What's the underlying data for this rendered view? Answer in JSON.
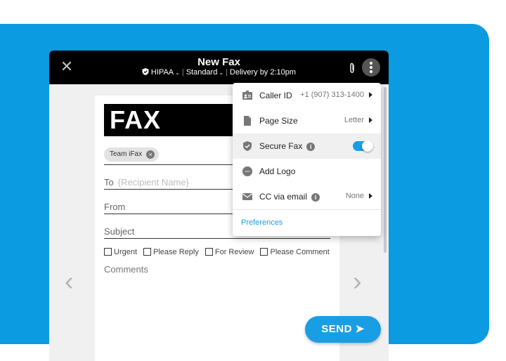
{
  "window": {
    "title": "New Fax",
    "hipaa_label": "HIPAA",
    "standard_label": "Standard",
    "delivery_label": "Delivery by 2:10pm",
    "close_glyph": "✕"
  },
  "form": {
    "logo_text": "FAX",
    "chip_label": "Team iFax",
    "chip_remove": "×",
    "to_label": "To",
    "to_placeholder": "{Recipient Name}",
    "from_label": "From",
    "subject_label": "Subject",
    "checkboxes": [
      "Urgent",
      "Please Reply",
      "For Review",
      "Please Comment"
    ],
    "comments_label": "Comments"
  },
  "nav": {
    "prev": "‹",
    "next": "›"
  },
  "send_label": "SEND ➤",
  "menu": {
    "caller_id_label": "Caller ID",
    "caller_id_value": "+1 (907) 313-1400",
    "page_size_label": "Page Size",
    "page_size_value": "Letter",
    "secure_fax_label": "Secure Fax",
    "secure_fax_enabled": true,
    "add_logo_label": "Add Logo",
    "cc_email_label": "CC via email",
    "cc_email_value": "None",
    "info_glyph": "i",
    "preferences_label": "Preferences"
  },
  "colors": {
    "accent": "#1a9ee3",
    "panel_blue": "#0a9be0",
    "titlebar": "#000000"
  },
  "icons": [
    "close-icon",
    "shield-icon",
    "paperclip-icon",
    "more-vertical-icon",
    "id-card-icon",
    "document-icon",
    "shield-check-icon",
    "logo-icon",
    "mail-icon",
    "info-icon",
    "chevron-left-icon",
    "chevron-right-icon",
    "send-arrow-icon"
  ]
}
